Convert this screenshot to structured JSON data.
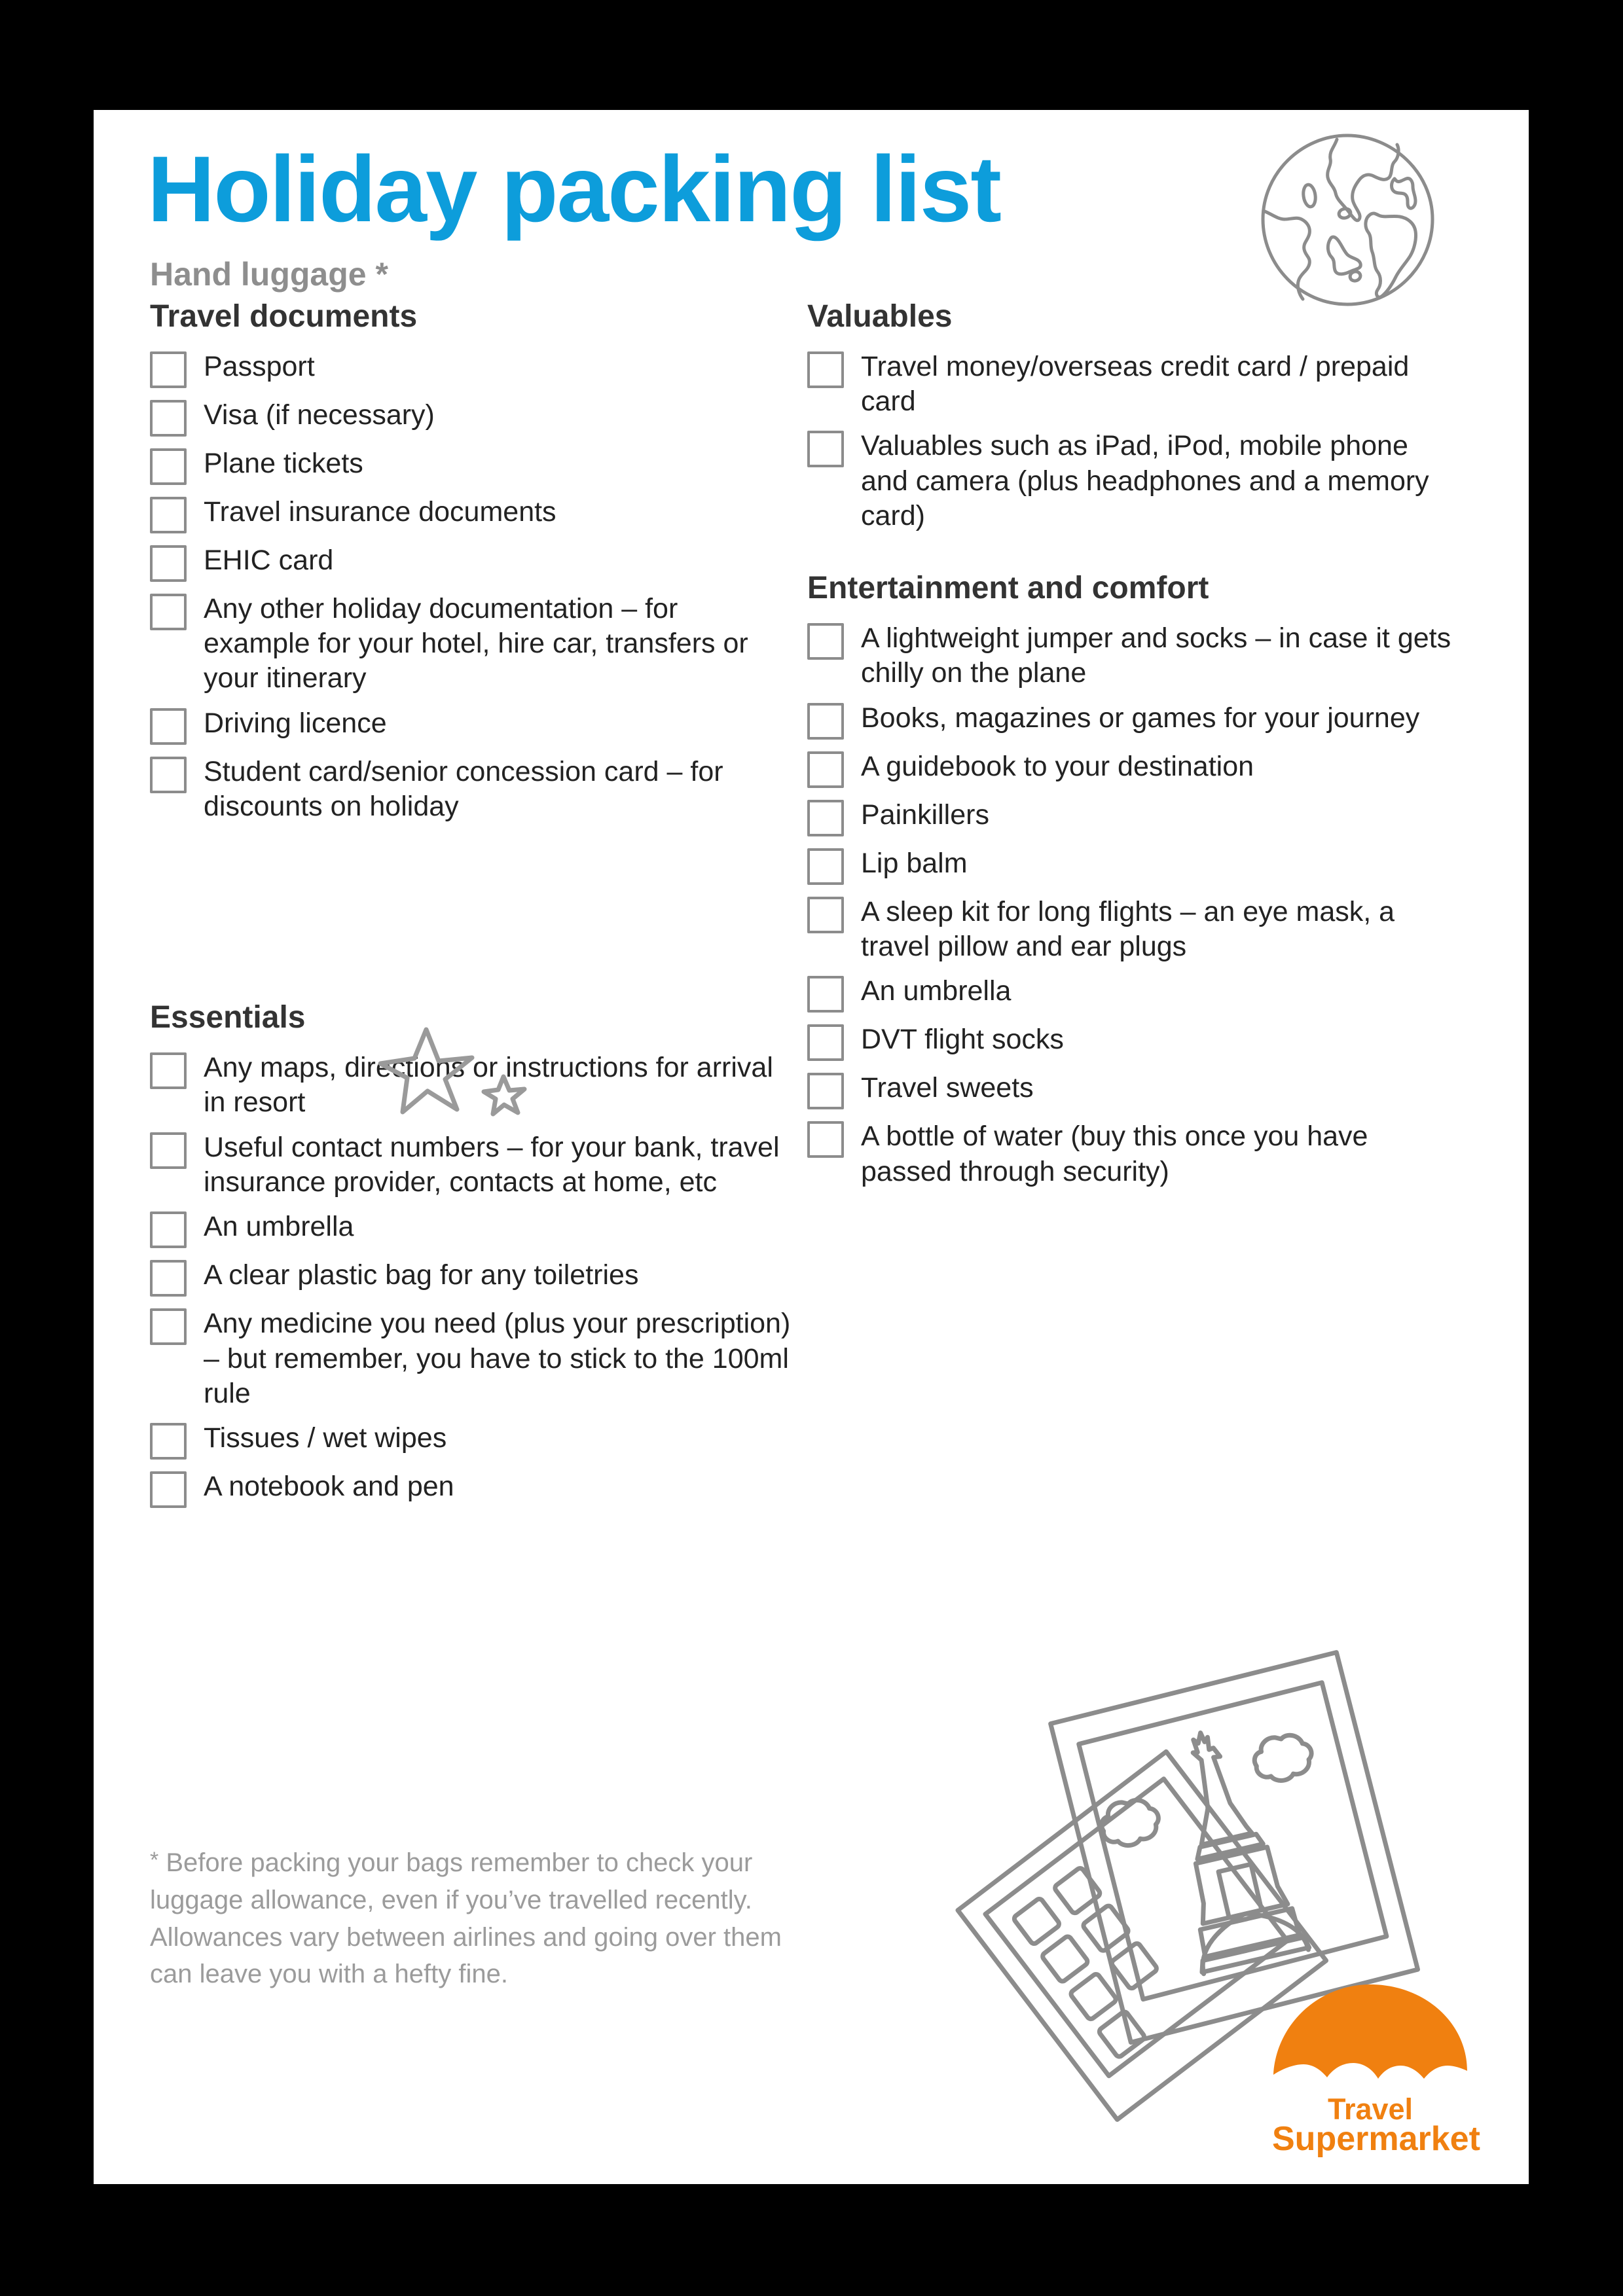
{
  "header": {
    "title": "Holiday packing list",
    "subtitle": "Hand luggage *",
    "title_color": "#0D9DDB",
    "subtitle_color": "#8e8e8e"
  },
  "sections": [
    {
      "id": "travel-documents",
      "heading": "Travel documents",
      "column": "left",
      "items": [
        "Passport",
        "Visa (if necessary)",
        "Plane tickets",
        "Travel insurance documents",
        "EHIC card",
        "Any other holiday documentation – for example for your hotel, hire car, transfers or your itinerary",
        "Driving licence",
        "Student card/senior concession card – for discounts on holiday"
      ]
    },
    {
      "id": "essentials",
      "heading": "Essentials",
      "column": "left",
      "items": [
        "Any maps, directions or instructions for arrival in resort",
        "Useful contact numbers – for your bank, travel insurance provider, contacts at home, etc",
        "An umbrella",
        "A clear plastic bag for any toiletries",
        "Any medicine you need (plus your prescription) – but remember, you have to stick to the 100ml rule",
        "Tissues / wet wipes",
        "A notebook and pen"
      ]
    },
    {
      "id": "valuables",
      "heading": "Valuables",
      "column": "right",
      "items": [
        "Travel money/overseas credit card / prepaid card",
        "Valuables such as iPad, iPod, mobile phone and camera (plus headphones and a memory card)"
      ]
    },
    {
      "id": "entertainment-and-comfort",
      "heading": "Entertainment and comfort",
      "column": "right",
      "items": [
        "A lightweight jumper and socks – in case it gets chilly on the plane",
        "Books, magazines or games for your journey",
        "A guidebook to your destination",
        "Painkillers",
        "Lip balm",
        "A sleep kit for long flights – an eye mask, a travel pillow and ear plugs",
        "An umbrella",
        "DVT flight socks",
        "Travel sweets",
        "A bottle of water (buy this once you have passed through security)"
      ]
    }
  ],
  "footnote": {
    "marker": "*",
    "text": "Before packing your bags remember to check your luggage allowance, even if you’ve travelled recently. Allowances vary between airlines and going over them can leave you with a hefty fine."
  },
  "logo": {
    "line1": "Travel",
    "line2": "Supermarket",
    "color": "#F08010"
  },
  "decorations": {
    "globe": "globe-icon",
    "stars": "stars-icon",
    "photos": "polaroid-photos-icon",
    "line_color": "#8c8c8c"
  }
}
